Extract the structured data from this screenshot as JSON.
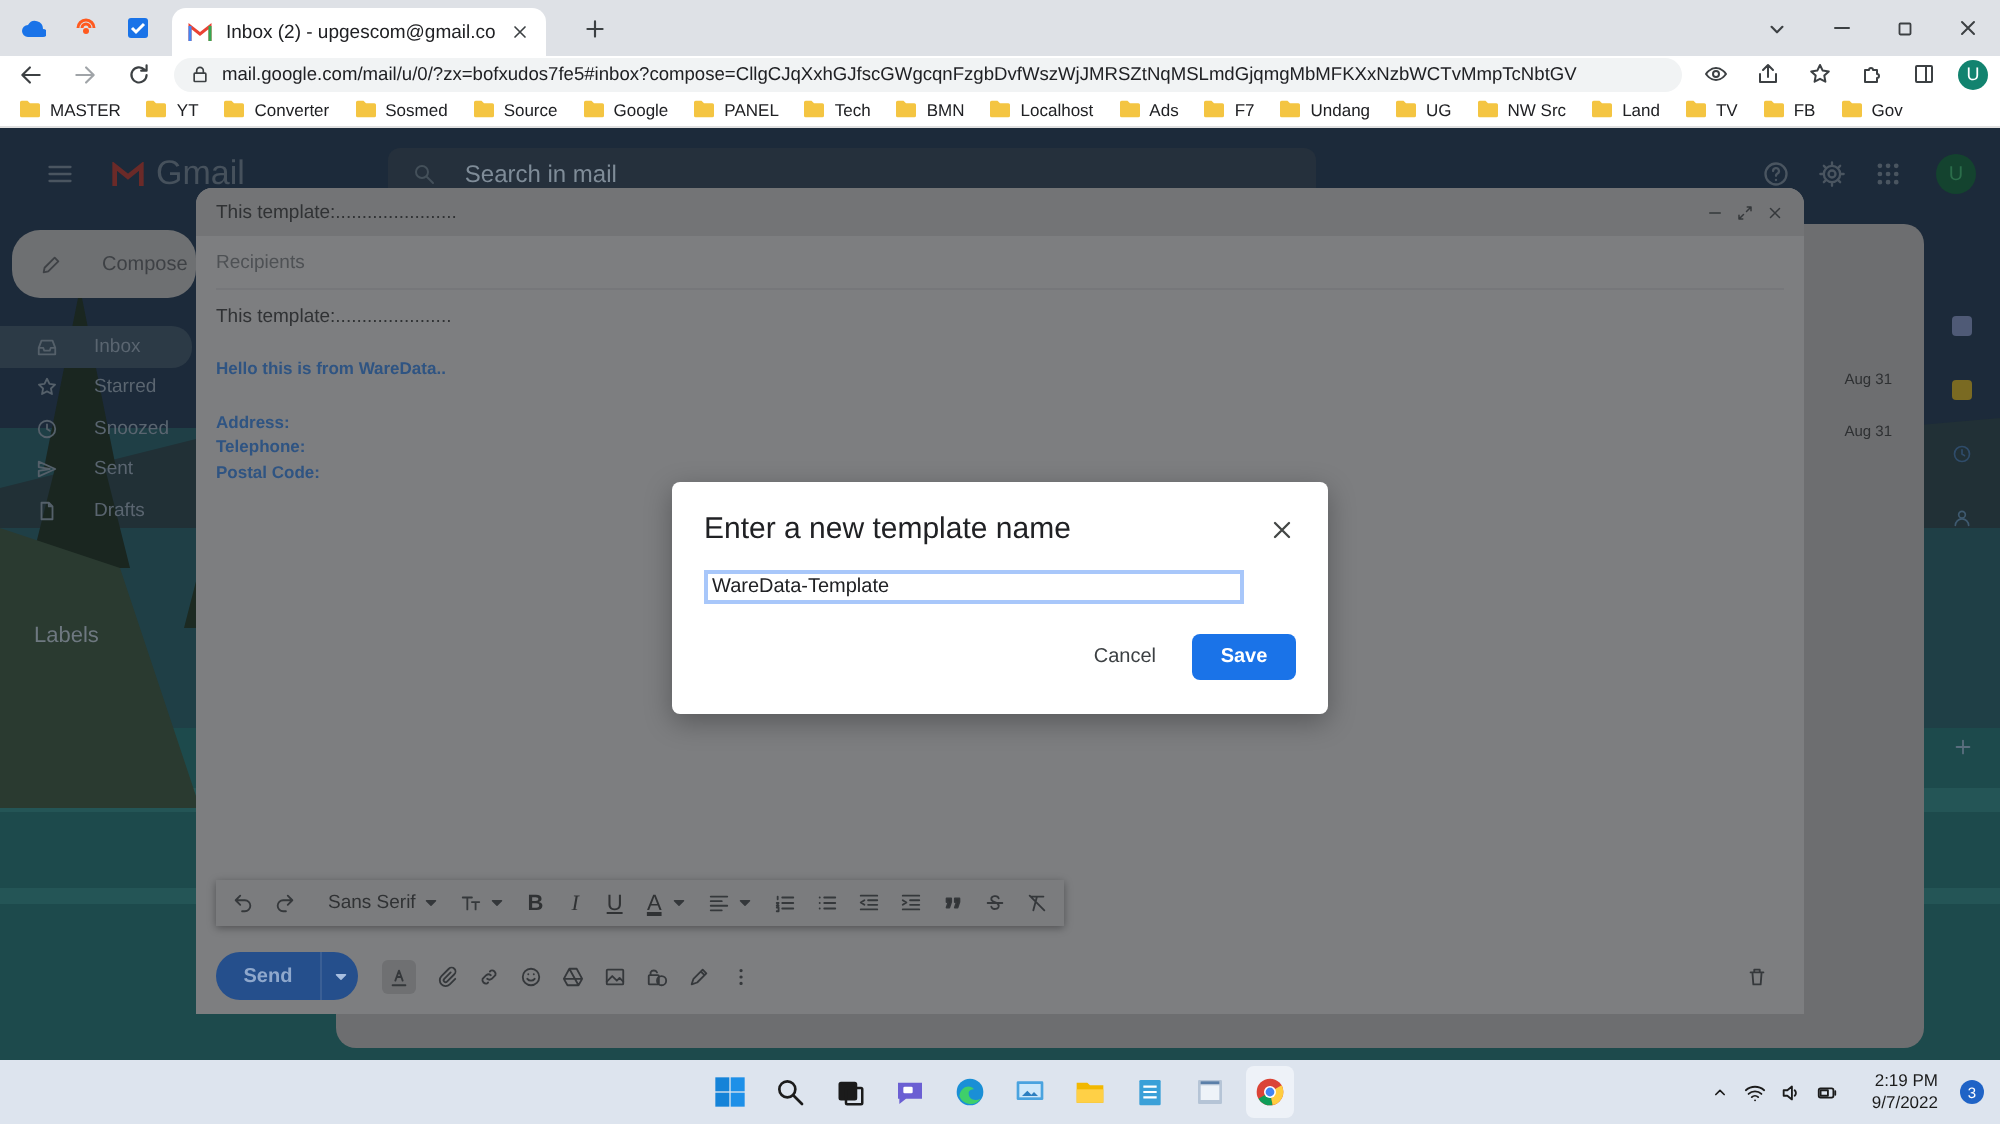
{
  "browser": {
    "tabs": [
      {
        "kind": "pinned",
        "selected": false
      },
      {
        "kind": "pinned",
        "selected": false
      },
      {
        "kind": "pinned",
        "selected": false
      },
      {
        "kind": "page",
        "title": "Inbox (2) - upgescom@gmail.co",
        "selected": true
      }
    ],
    "url": "mail.google.com/mail/u/0/?zx=bofxudos7fe5#inbox?compose=CllgCJqXxhGJfscGWgcqnFzgbDvfWszWjJMRSZtNqMSLmdGjqmgMbMFKXxNzbWCTvMmpTcNbtGV",
    "profile_initial": "U",
    "bookmarks": [
      "MASTER",
      "YT",
      "Converter",
      "Sosmed",
      "Source",
      "Google",
      "PANEL",
      "Tech",
      "BMN",
      "Localhost",
      "Ads",
      "F7",
      "Undang",
      "UG",
      "NW Src",
      "Land",
      "TV",
      "FB",
      "Gov"
    ]
  },
  "gmail": {
    "logo": "Gmail",
    "search_placeholder": "Search in mail",
    "avatar_initial": "U",
    "compose_label": "Compose",
    "nav": [
      {
        "label": "Inbox",
        "selected": true
      },
      {
        "label": "Starred",
        "selected": false
      },
      {
        "label": "Snoozed",
        "selected": false
      },
      {
        "label": "Sent",
        "selected": false
      },
      {
        "label": "Drafts",
        "selected": false
      }
    ],
    "labels_heading": "Labels",
    "mail_dates": [
      "Aug 31",
      "Aug 31"
    ]
  },
  "compose": {
    "title": "This template:.......................",
    "recipients_placeholder": "Recipients",
    "body": [
      {
        "kind": "plain",
        "lines": [
          "This template:......................"
        ]
      },
      {
        "kind": "blue",
        "lines": [
          "Hello this is from WareData.."
        ]
      },
      {
        "kind": "blue",
        "lines": [
          "Address:",
          "Telephone:",
          "Postal Code:"
        ]
      }
    ],
    "font": "Sans Serif",
    "bold": "B",
    "italic": "I",
    "underline": "U",
    "text_color": "A",
    "send": "Send"
  },
  "dialog": {
    "title": "Enter a new template name",
    "value": "WareData-Template",
    "cancel": "Cancel",
    "save": "Save"
  },
  "taskbar": {
    "time": "2:19 PM",
    "date": "9/7/2022",
    "notifications": "3"
  }
}
